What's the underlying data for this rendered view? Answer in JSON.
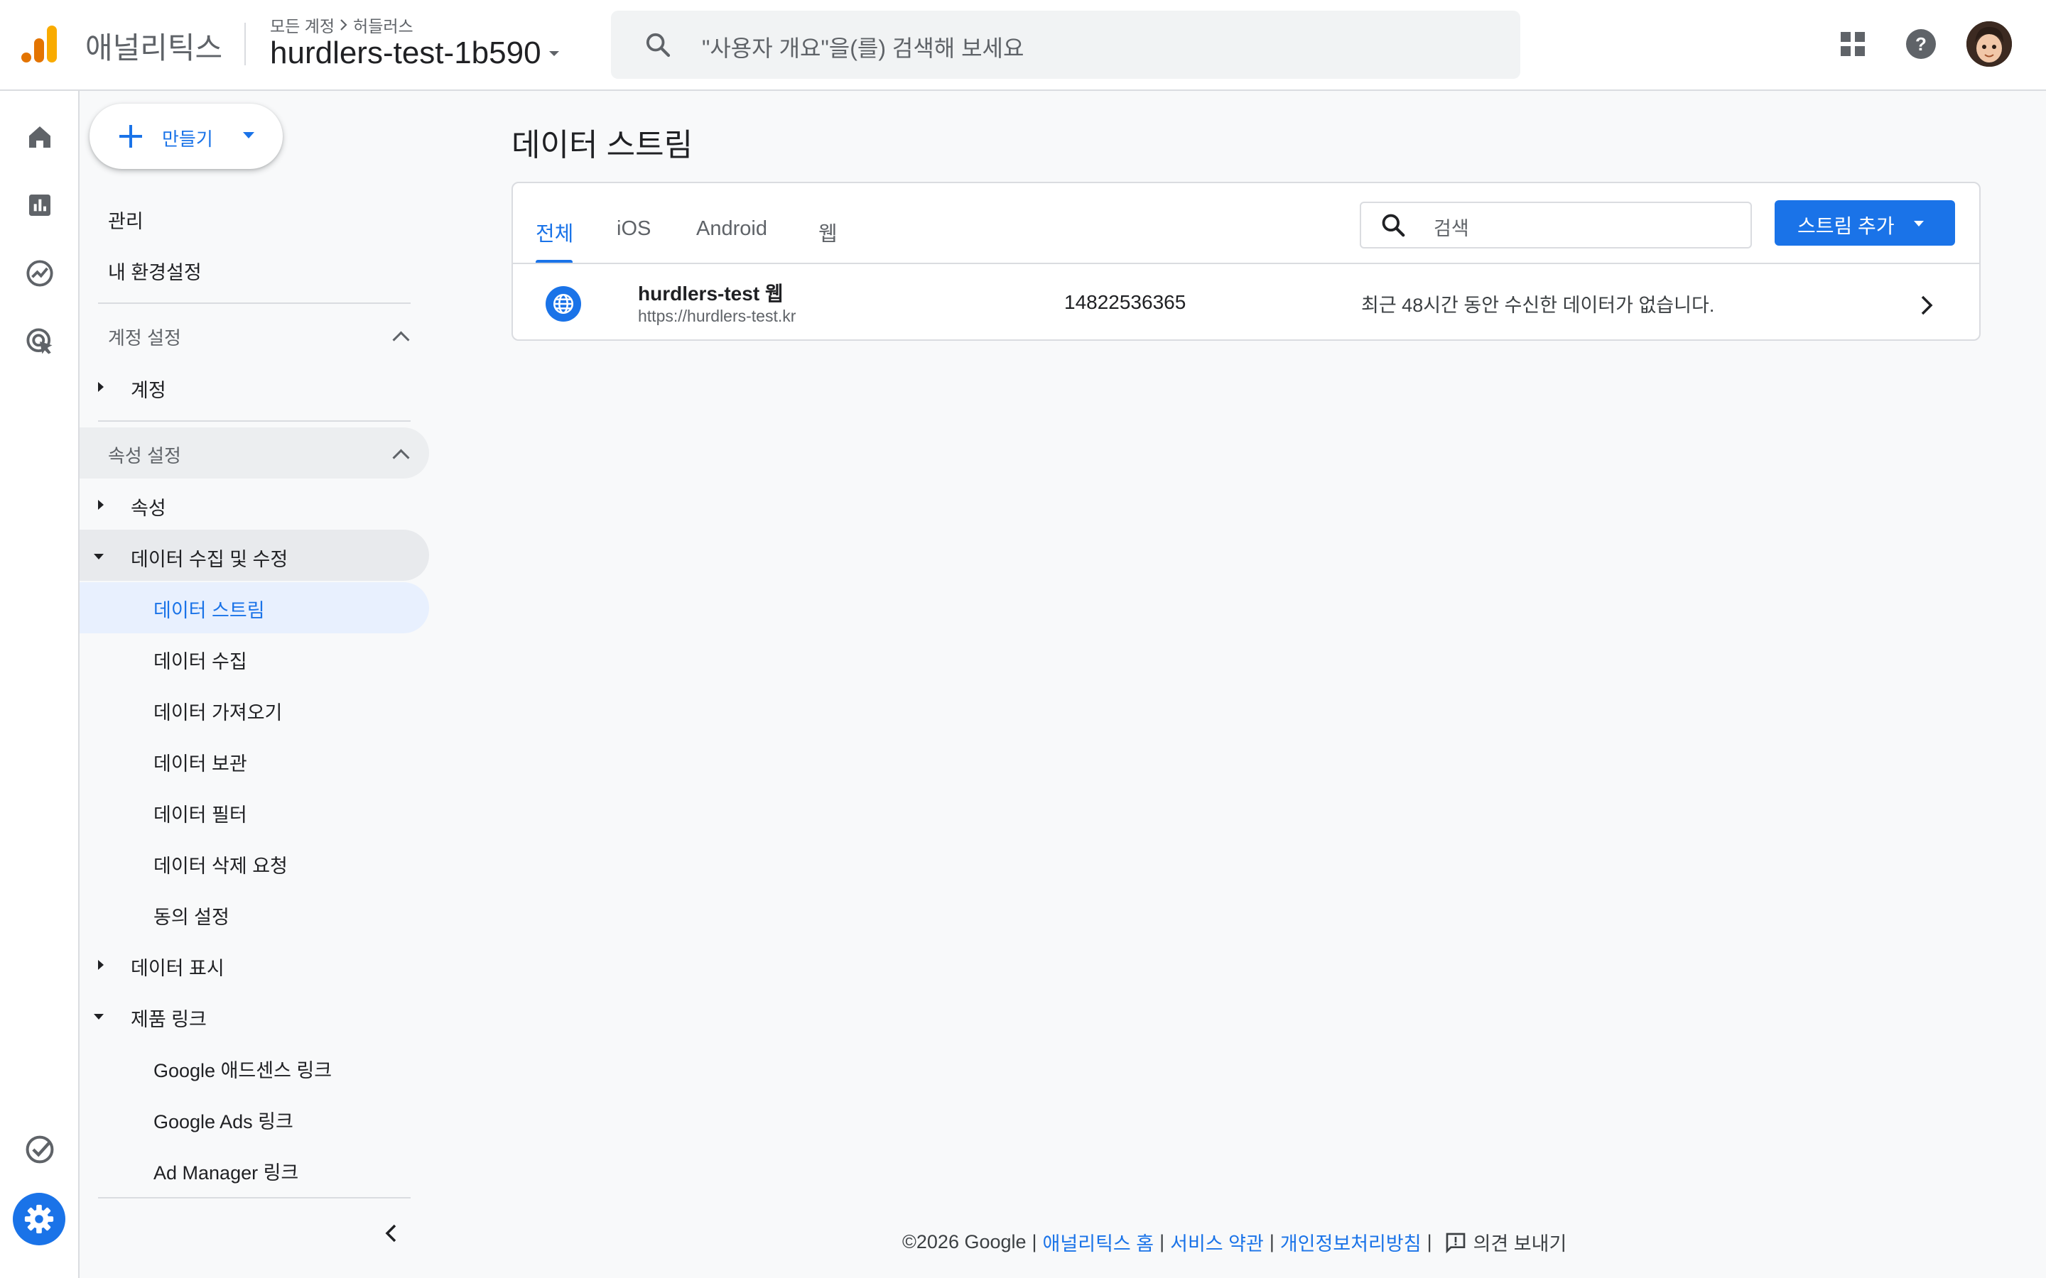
{
  "header": {
    "app_name": "애널리틱스",
    "breadcrumb": {
      "account": "모든 계정",
      "property": "허들러스"
    },
    "property_title": "hurdlers-test-1b590",
    "search_placeholder": "\"사용자 개요\"을(를) 검색해 보세요",
    "icons": [
      "apps-grid-icon",
      "help-icon",
      "account-avatar"
    ]
  },
  "rail": {
    "items": [
      "home-icon",
      "reports-icon",
      "explore-icon",
      "advertising-icon",
      "task-check-icon",
      "settings-gear-icon"
    ]
  },
  "nav": {
    "create_label": "만들기",
    "admin": "관리",
    "my_prefs": "내 환경설정",
    "account_settings": "계정 설정",
    "account": "계정",
    "property_settings": "속성 설정",
    "property": "속성",
    "data_collection_modify": "데이터 수집 및 수정",
    "sub": {
      "data_streams": "데이터 스트림",
      "data_collection": "데이터 수집",
      "data_import": "데이터 가져오기",
      "data_retention": "데이터 보관",
      "data_filters": "데이터 필터",
      "data_deletion": "데이터 삭제 요청",
      "consent": "동의 설정"
    },
    "data_display": "데이터 표시",
    "product_links": "제품 링크",
    "links": {
      "adsense": "Google 애드센스 링크",
      "ads": "Google Ads 링크",
      "admanager": "Ad Manager 링크"
    }
  },
  "main": {
    "title": "데이터 스트림",
    "tabs": [
      "전체",
      "iOS",
      "Android",
      "웹"
    ],
    "active_tab": "전체",
    "search_placeholder": "검색",
    "add_button": "스트림 추가",
    "streams": [
      {
        "name": "hurdlers-test 웹",
        "url": "https://hurdlers-test.kr",
        "id": "14822536365",
        "status": "최근 48시간 동안 수신한 데이터가 없습니다.",
        "icon": "web-globe-icon"
      }
    ]
  },
  "footer": {
    "copyright": "©2026 Google",
    "sep": "|",
    "home": "애널리틱스 홈",
    "terms": "서비스 약관",
    "privacy": "개인정보처리방침",
    "feedback": "의견 보내기"
  },
  "colors": {
    "accent": "#1a73e8",
    "logo_orange": "#f9ab00",
    "logo_dark_orange": "#e37400"
  }
}
